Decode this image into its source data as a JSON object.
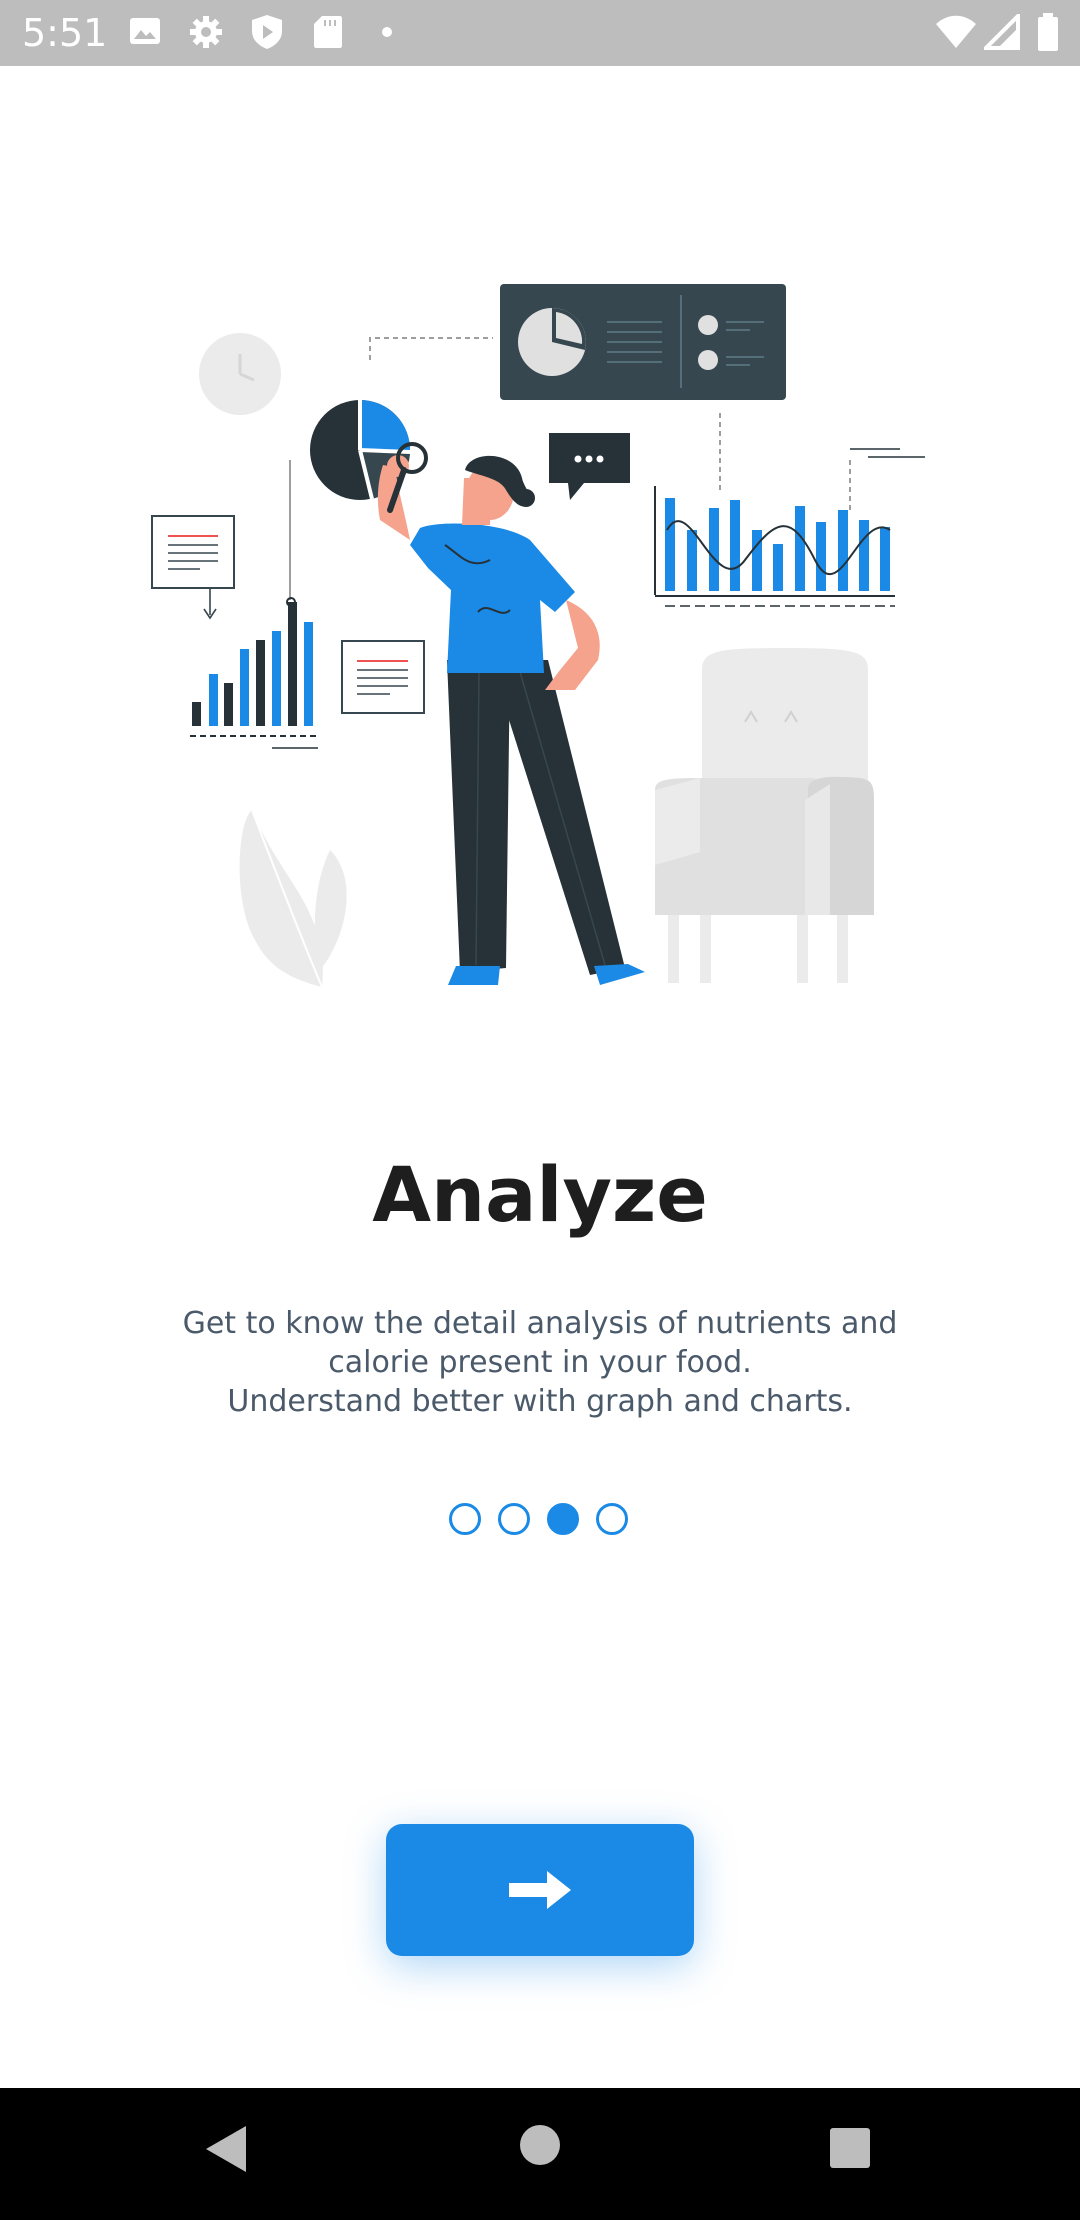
{
  "status_bar": {
    "time": "5:51",
    "left_icons": [
      "image-icon",
      "gear-icon",
      "shield-icon",
      "sd-card-icon",
      "dot-icon"
    ],
    "right_icons": [
      "wifi-icon",
      "signal-icon",
      "battery-icon"
    ]
  },
  "onboarding": {
    "title": "Analyze",
    "description_lines": [
      "Get to know the detail analysis of nutrients and",
      "calorie present in your food.",
      "Understand better with graph and charts."
    ],
    "page_count": 4,
    "active_page": 3
  },
  "next_button": {
    "icon": "arrow-right-icon"
  },
  "nav_bar": {
    "buttons": [
      "back-icon",
      "home-icon",
      "recents-icon"
    ]
  },
  "colors": {
    "accent": "#1a8ae6",
    "status_bar": "#bdbdbd",
    "title": "#1e1e1e",
    "body_text": "#4b5a6a",
    "illustration_dark": "#263238"
  }
}
